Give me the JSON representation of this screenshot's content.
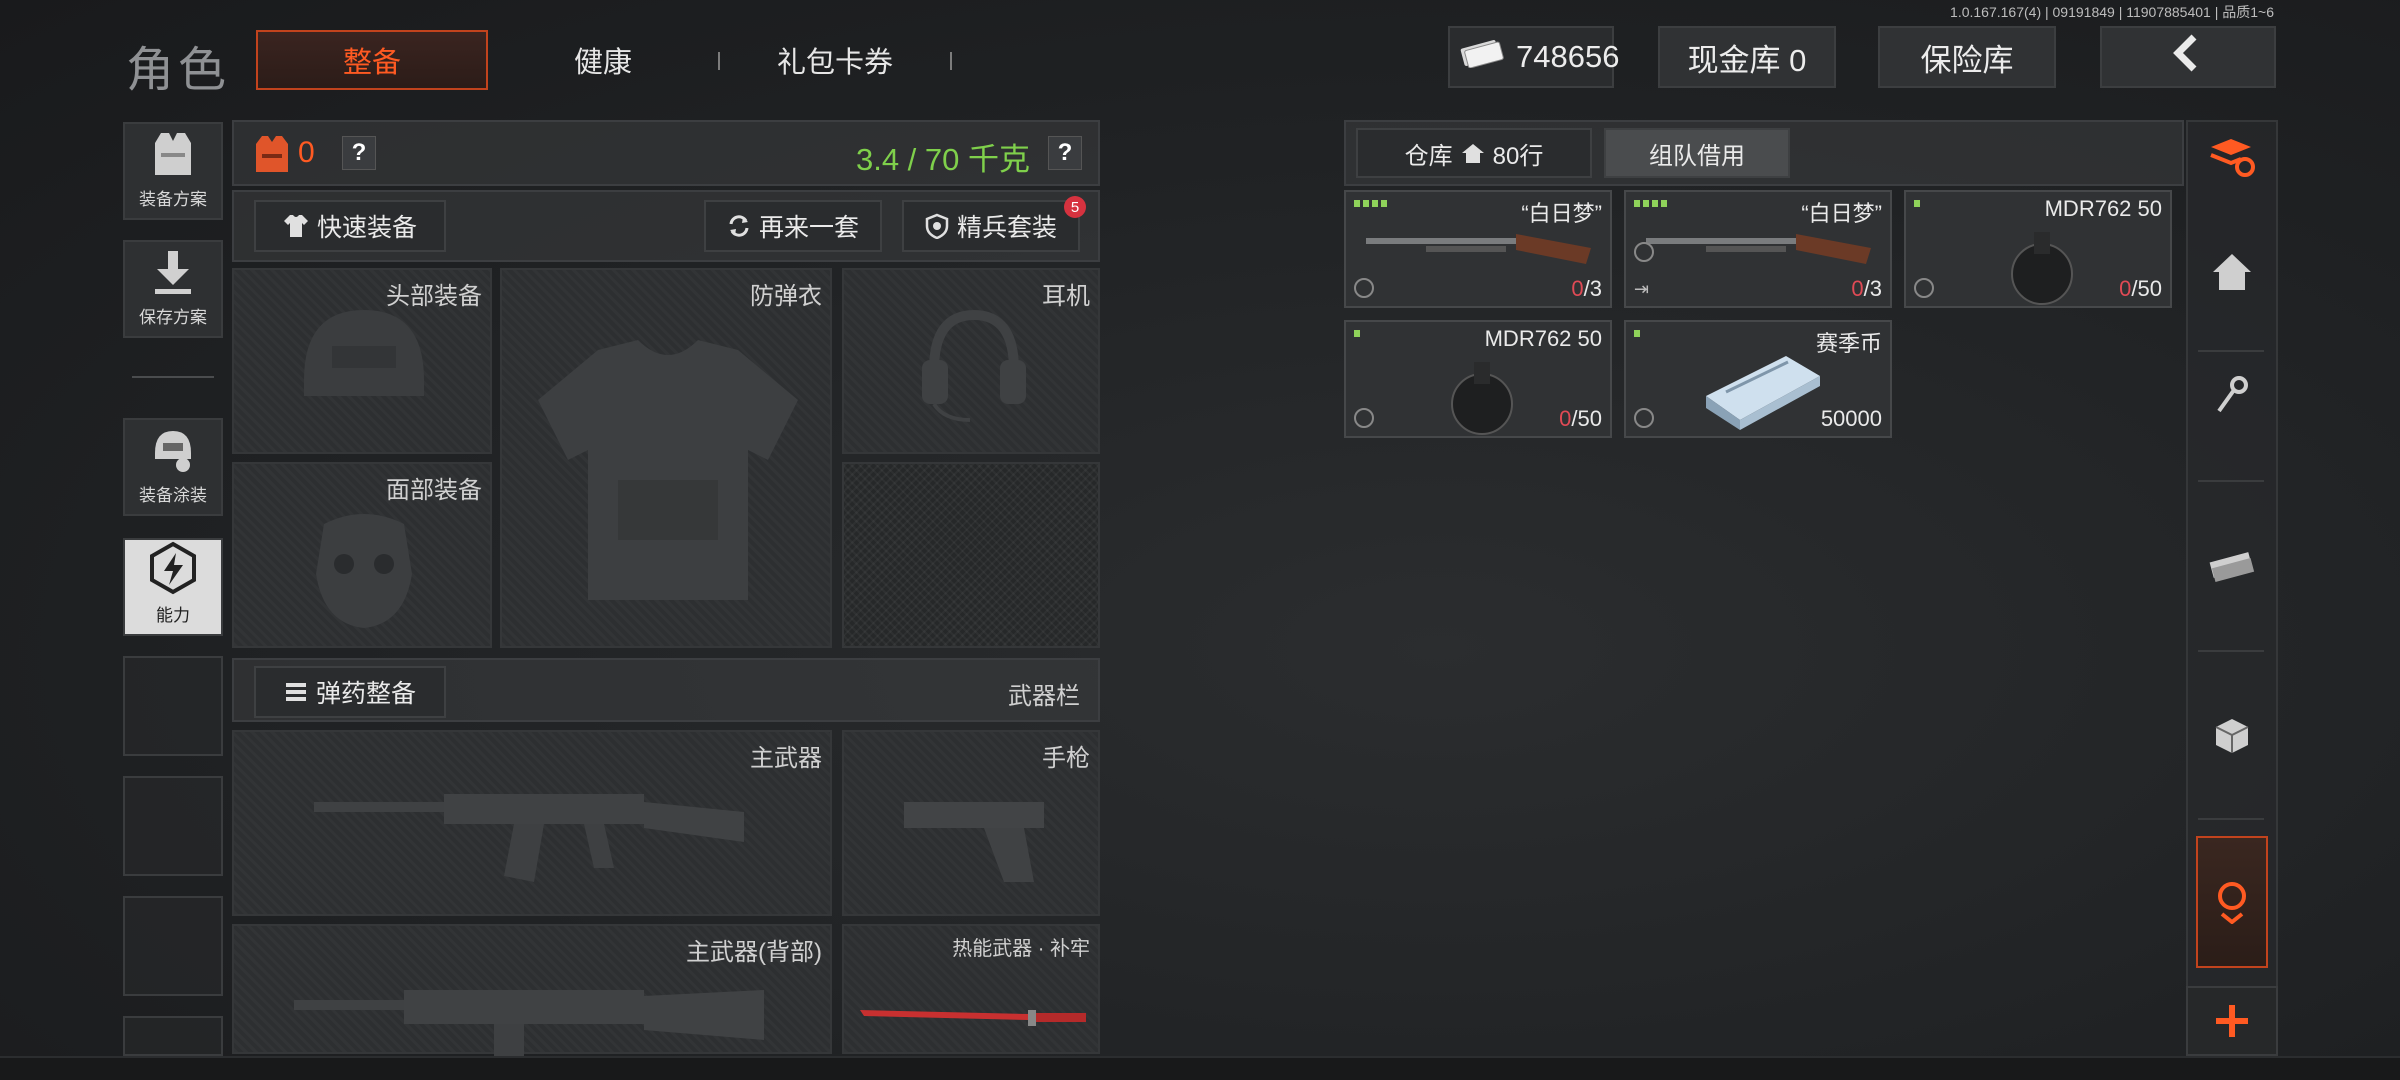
{
  "version": "1.0.167.167(4) | 09191849 | 11907885401 | 品质1~6",
  "header": {
    "title": "角色",
    "tabs": [
      "整备",
      "健康",
      "礼包卡券"
    ],
    "currency_value": "748656",
    "cash_vault": "现金库 0",
    "safe_box": "保险库"
  },
  "left_menu": {
    "equip_plan": "装备方案",
    "save_plan": "保存方案",
    "equip_skin": "装备涂装",
    "ability": "能力"
  },
  "loadout": {
    "armor_count": "0",
    "help": "?",
    "weight": "3.4 / 70 千克",
    "quick_equip": "快速装备",
    "repeat": "再来一套",
    "elite_set": "精兵套装",
    "elite_badge": "5",
    "slots": {
      "head": "头部装备",
      "vest": "防弹衣",
      "headset": "耳机",
      "face": "面部装备"
    },
    "ammo_btn": "弹药整备",
    "weapon_bar": "武器栏",
    "weapons": {
      "primary": "主武器",
      "pistol": "手枪",
      "primary_back": "主武器(背部)",
      "melee": "热能武器 · 补牢"
    }
  },
  "storage": {
    "warehouse_label": "仓库",
    "warehouse_rows": "80行",
    "team_borrow": "组队借用",
    "items": [
      {
        "name": "“白日梦”",
        "count_red": "0",
        "count_rest": "/3",
        "bars": 4
      },
      {
        "name": "“白日梦”",
        "count_red": "0",
        "count_rest": "/3",
        "bars": 4
      },
      {
        "name": "MDR762 50",
        "count_red": "0",
        "count_rest": "/50",
        "bars": 1
      },
      {
        "name": "MDR762 50",
        "count_red": "0",
        "count_rest": "/50",
        "bars": 1
      },
      {
        "name": "赛季币",
        "count_red": "",
        "count_rest": "50000",
        "bars": 1
      }
    ]
  },
  "colors": {
    "accent": "#ff5a22",
    "weight_green": "#7fd04b",
    "count_red": "#e04a55"
  }
}
